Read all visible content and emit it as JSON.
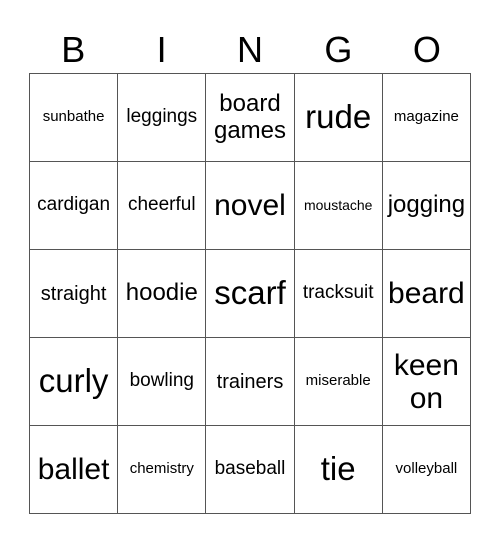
{
  "header": [
    "B",
    "I",
    "N",
    "G",
    "O"
  ],
  "cells": [
    {
      "text": "sunbathe",
      "size": "s15"
    },
    {
      "text": "leggings",
      "size": "s17"
    },
    {
      "text": "board games",
      "size": "s24"
    },
    {
      "text": "rude",
      "size": "s32"
    },
    {
      "text": "magazine",
      "size": "s15"
    },
    {
      "text": "cardigan",
      "size": "s17"
    },
    {
      "text": "cheerful",
      "size": "s17"
    },
    {
      "text": "novel",
      "size": "s28"
    },
    {
      "text": "moustache",
      "size": "s13"
    },
    {
      "text": "jogging",
      "size": "s24"
    },
    {
      "text": "straight",
      "size": "s20"
    },
    {
      "text": "hoodie",
      "size": "s24"
    },
    {
      "text": "scarf",
      "size": "s32"
    },
    {
      "text": "tracksuit",
      "size": "s17"
    },
    {
      "text": "beard",
      "size": "s28"
    },
    {
      "text": "curly",
      "size": "s32"
    },
    {
      "text": "bowling",
      "size": "s17"
    },
    {
      "text": "trainers",
      "size": "s20"
    },
    {
      "text": "miserable",
      "size": "s15"
    },
    {
      "text": "keen on",
      "size": "s28"
    },
    {
      "text": "ballet",
      "size": "s28"
    },
    {
      "text": "chemistry",
      "size": "s15"
    },
    {
      "text": "baseball",
      "size": "s17"
    },
    {
      "text": "tie",
      "size": "s32"
    },
    {
      "text": "volleyball",
      "size": "s15"
    }
  ]
}
